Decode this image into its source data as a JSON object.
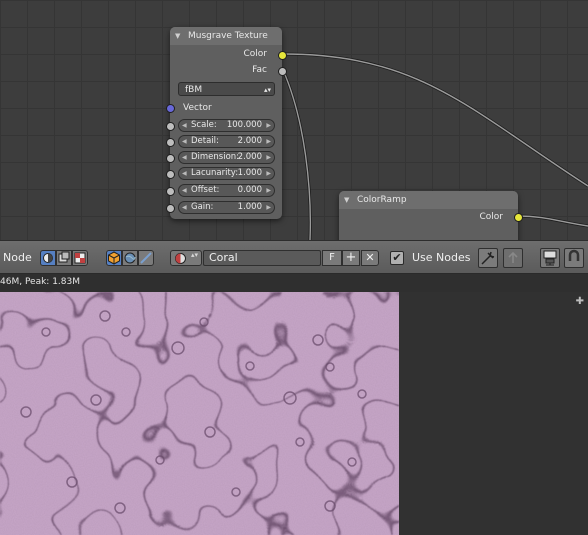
{
  "node_editor": {
    "musgrave_node": {
      "title": "Musgrave Texture",
      "outputs": [
        "Color",
        "Fac"
      ],
      "type_value": "fBM",
      "vector_label": "Vector",
      "fields": [
        {
          "label": "Scale:",
          "value": "100.000"
        },
        {
          "label": "Detail:",
          "value": "2.000"
        },
        {
          "label": "Dimension:",
          "value": "2.000"
        },
        {
          "label": "Lacunarity:",
          "value": "1.000"
        },
        {
          "label": "Offset:",
          "value": "0.000"
        },
        {
          "label": "Gain:",
          "value": "1.000"
        }
      ]
    },
    "colorramp_node": {
      "title": "ColorRamp",
      "output": "Color"
    }
  },
  "header": {
    "menu_label": "Node",
    "material_name": "Coral",
    "fake_user_label": "F",
    "use_nodes_label": "Use Nodes",
    "use_nodes_checked": true
  },
  "viewport": {
    "stats": "46M, Peak: 1.83M"
  },
  "colors": {
    "socket_color": "#e6e63b",
    "socket_float": "#bdbdbd",
    "socket_vector": "#6868d8",
    "active_button": "#5680c2",
    "render_base": "#c8a7c9"
  }
}
